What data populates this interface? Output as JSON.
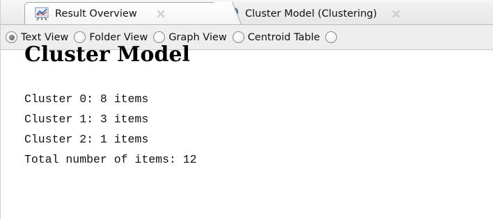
{
  "tabs": [
    {
      "label": "Result Overview",
      "icon": "result-overview-icon",
      "active": true
    },
    {
      "label": "Cluster Model (Clustering)",
      "icon": "cluster-model-icon",
      "active": false
    }
  ],
  "views": [
    {
      "label": "Text View",
      "selected": true
    },
    {
      "label": "Folder View",
      "selected": false
    },
    {
      "label": "Graph View",
      "selected": false
    },
    {
      "label": "Centroid Table",
      "selected": false
    }
  ],
  "content": {
    "title": "Cluster Model",
    "lines": [
      "Cluster 0: 8 items",
      "Cluster 1: 3 items",
      "Cluster 2: 1 items",
      "Total number of items: 12"
    ]
  }
}
